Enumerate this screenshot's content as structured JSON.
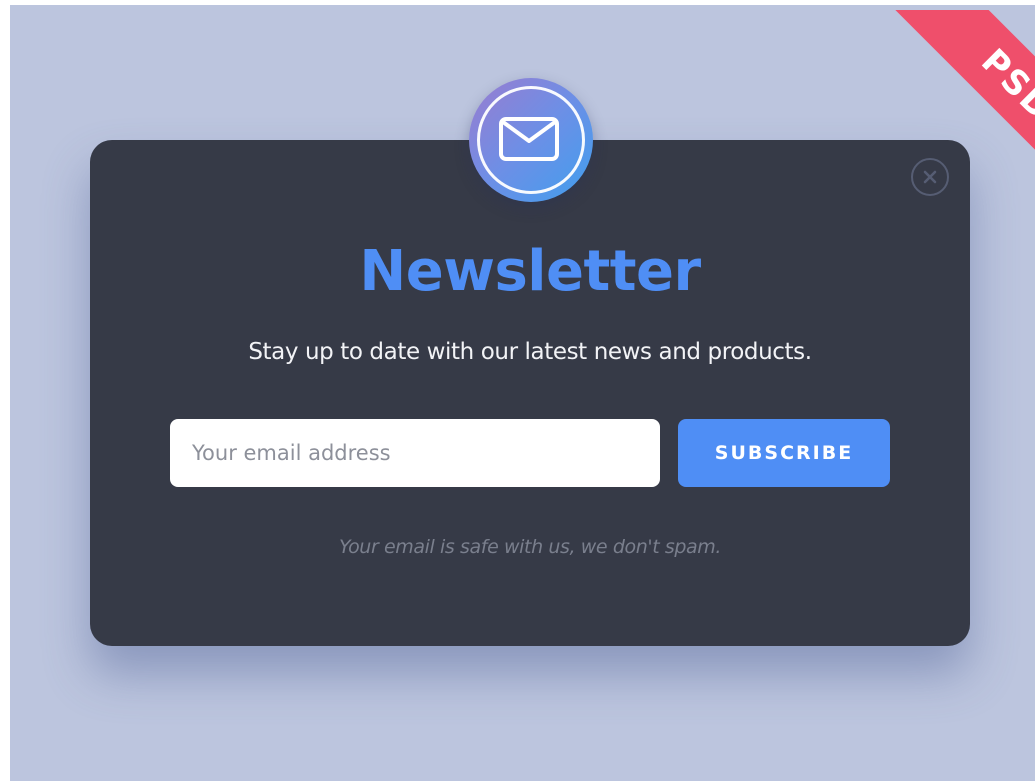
{
  "ribbon": {
    "label": "PSD",
    "color": "#ef4f6b"
  },
  "modal": {
    "badge_icon": "envelope-icon",
    "close_icon": "close-icon",
    "title": "Newsletter",
    "subtitle": "Stay up to date with our latest news and products.",
    "email": {
      "value": "",
      "placeholder": "Your email address"
    },
    "subscribe_label": "SUBSCRIBE",
    "note": "Your email is safe with us, we don't spam."
  },
  "colors": {
    "backdrop": "#bcc5de",
    "modal": "#363a47",
    "accent": "#4f8ef5",
    "muted_text": "#7a7f8d"
  }
}
